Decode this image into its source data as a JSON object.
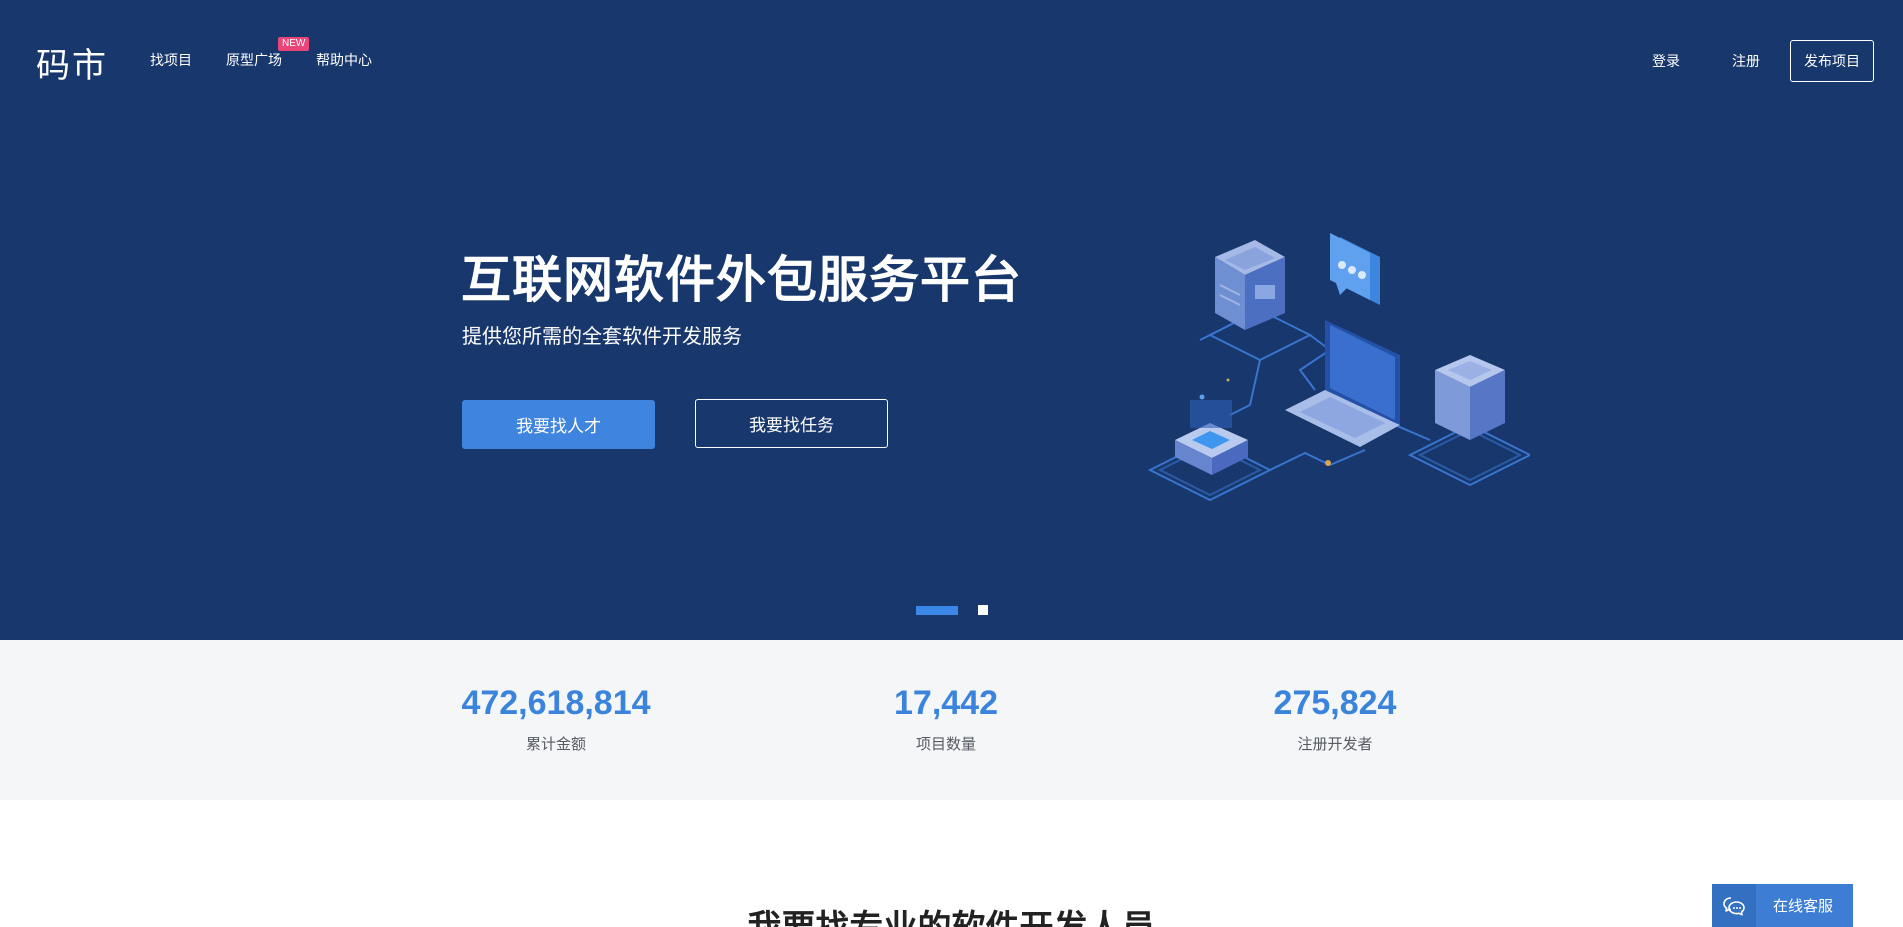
{
  "header": {
    "logo": "码市",
    "nav": [
      {
        "label": "找项目"
      },
      {
        "label": "原型广场",
        "badge": "NEW"
      },
      {
        "label": "帮助中心"
      }
    ],
    "login": "登录",
    "register": "注册",
    "publish": "发布项目"
  },
  "hero": {
    "title": "互联网软件外包服务平台",
    "subtitle": "提供您所需的全套软件开发服务",
    "btn_find_talent": "我要找人才",
    "btn_find_task": "我要找任务",
    "carousel": {
      "slides": 2,
      "active": 1
    }
  },
  "stats": [
    {
      "value": "472,618,814",
      "label": "累计金额"
    },
    {
      "value": "17,442",
      "label": "项目数量"
    },
    {
      "value": "275,824",
      "label": "注册开发者"
    }
  ],
  "section": {
    "title": "我要找专业的软件开发人员"
  },
  "service": {
    "label": "在线客服"
  },
  "colors": {
    "hero_bg": "#17376d",
    "accent": "#3f84df",
    "stats_bg": "#f5f6f8",
    "stat_value": "#3a84dc",
    "badge": "#e8457a"
  }
}
